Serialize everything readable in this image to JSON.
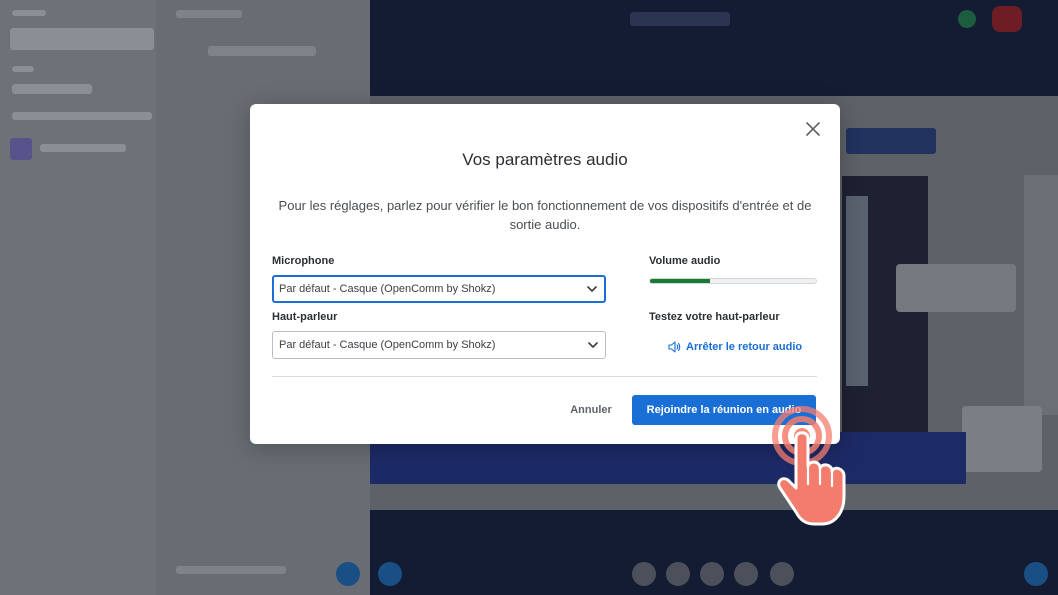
{
  "dialog": {
    "title": "Vos paramètres audio",
    "description": "Pour les réglages, parlez pour vérifier le bon fonctionnement de vos dispositifs d'entrée et de sortie audio.",
    "close_icon": "close-icon",
    "microphone": {
      "label": "Microphone",
      "selected": "Par défaut - Casque (OpenComm by Shokz)"
    },
    "speaker": {
      "label": "Haut-parleur",
      "selected": "Par défaut - Casque (OpenComm by Shokz)"
    },
    "volume": {
      "label": "Volume audio",
      "level": 0.36,
      "fill_color": "#1a7a34"
    },
    "speaker_test": {
      "label": "Testez votre haut-parleur",
      "link_label": "Arrêter le retour audio",
      "icon": "speaker-icon"
    },
    "buttons": {
      "cancel": "Annuler",
      "join": "Rejoindre la réunion en audio"
    }
  },
  "colors": {
    "primary": "#1a6fd6",
    "pointer": "#f47c6c"
  }
}
